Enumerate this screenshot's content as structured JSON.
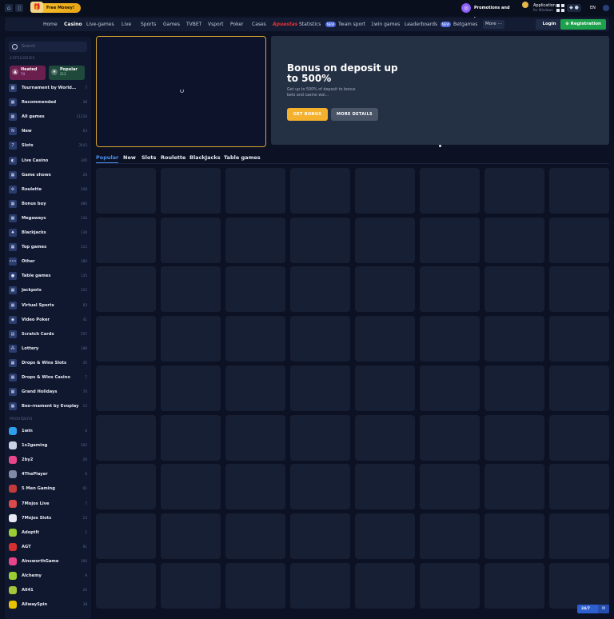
{
  "topbar": {
    "free_money": "Free Money!",
    "promotions": "Promotions and bonuses",
    "app_title": "Application",
    "app_sub": "for Windows",
    "lang": "EN"
  },
  "nav": {
    "items": [
      "Home",
      "Casino",
      "Live-games",
      "Live",
      "Sports",
      "Games",
      "TVBET",
      "Vsport",
      "Poker",
      "Cases",
      "Apuestas",
      "Statistics",
      "Twain sport",
      "1win games",
      "Leaderboards",
      "Betgames"
    ],
    "new_badge": "NEW",
    "more": "More",
    "login": "Login",
    "registration": "Registration"
  },
  "sidebar": {
    "search_placeholder": "Search",
    "categories_label": "CATEGORIES",
    "hot": {
      "label": "Heated",
      "count": "74"
    },
    "popular": {
      "label": "Popular",
      "count": "212"
    },
    "categories": [
      {
        "label": "Tournament by WorldMatch",
        "count": "7",
        "icon": "grid-icon"
      },
      {
        "label": "Recommended",
        "count": "38",
        "icon": "grid-icon"
      },
      {
        "label": "All games",
        "count": "11216",
        "icon": "grid-icon"
      },
      {
        "label": "New",
        "count": "63",
        "icon": "new-icon"
      },
      {
        "label": "Slots",
        "count": "3543",
        "icon": "slots-icon"
      },
      {
        "label": "Live Casino",
        "count": "340",
        "icon": "live-icon"
      },
      {
        "label": "Game shows",
        "count": "26",
        "icon": "grid-icon"
      },
      {
        "label": "Roulette",
        "count": "208",
        "icon": "roulette-icon"
      },
      {
        "label": "Bonus buy",
        "count": "480",
        "icon": "grid-icon"
      },
      {
        "label": "Megaways",
        "count": "134",
        "icon": "grid-icon"
      },
      {
        "label": "Blackjacks",
        "count": "130",
        "icon": "cards-icon"
      },
      {
        "label": "Top games",
        "count": "113",
        "icon": "grid-icon"
      },
      {
        "label": "Other",
        "count": "180",
        "icon": "dots-icon"
      },
      {
        "label": "Table games",
        "count": "135",
        "icon": "chip-icon"
      },
      {
        "label": "Jackpots",
        "count": "123",
        "icon": "grid-icon"
      },
      {
        "label": "Virtual Sports",
        "count": "83",
        "icon": "grid-icon"
      },
      {
        "label": "Video Poker",
        "count": "41",
        "icon": "poker-icon"
      },
      {
        "label": "Scratch Cards",
        "count": "257",
        "icon": "scratch-icon"
      },
      {
        "label": "Lottery",
        "count": "188",
        "icon": "lottery-icon"
      },
      {
        "label": "Drops & Wins Slots",
        "count": "45",
        "icon": "grid-icon"
      },
      {
        "label": "Drops & Wins Casino",
        "count": "7",
        "icon": "grid-icon"
      },
      {
        "label": "Grand Holidays",
        "count": "70",
        "icon": "grid-icon"
      },
      {
        "label": "Boo-rnament by Evoplay",
        "count": "12",
        "icon": "grid-icon"
      }
    ],
    "providers_label": "PROVIDERS",
    "providers": [
      {
        "label": "1win",
        "count": "6",
        "color": "#2ea0ee"
      },
      {
        "label": "1x2gaming",
        "count": "102",
        "color": "#c9d1e2"
      },
      {
        "label": "2by2",
        "count": "26",
        "color": "#e8458a"
      },
      {
        "label": "4ThePlayer",
        "count": "6",
        "color": "#7f8aa6"
      },
      {
        "label": "5 Men Gaming",
        "count": "61",
        "color": "#c23a3a"
      },
      {
        "label": "7Mojos Live",
        "count": "7",
        "color": "#d94a4a"
      },
      {
        "label": "7Mojos Slots",
        "count": "23",
        "color": "#e6e9f2"
      },
      {
        "label": "AdoptIt",
        "count": "1",
        "color": "#9acd32"
      },
      {
        "label": "AGT",
        "count": "91",
        "color": "#d62f2f"
      },
      {
        "label": "AinsworthGame",
        "count": "100",
        "color": "#e8458a"
      },
      {
        "label": "Alchemy",
        "count": "9",
        "color": "#9acd32"
      },
      {
        "label": "All41",
        "count": "26",
        "color": "#a4c639"
      },
      {
        "label": "AllwaySpin",
        "count": "38",
        "color": "#e6c200"
      }
    ]
  },
  "banner": {
    "title": "Bonus on deposit up to 500%",
    "description": "Get up to 500% of deposit to bonus bets and casino wal...",
    "get_bonus": "GET BONUS",
    "more_details": "MORE DETAILS"
  },
  "tabs": [
    "Popular",
    "New",
    "Slots",
    "Roulette",
    "BlackJacks",
    "Table games"
  ],
  "support": {
    "label": "24/7"
  }
}
